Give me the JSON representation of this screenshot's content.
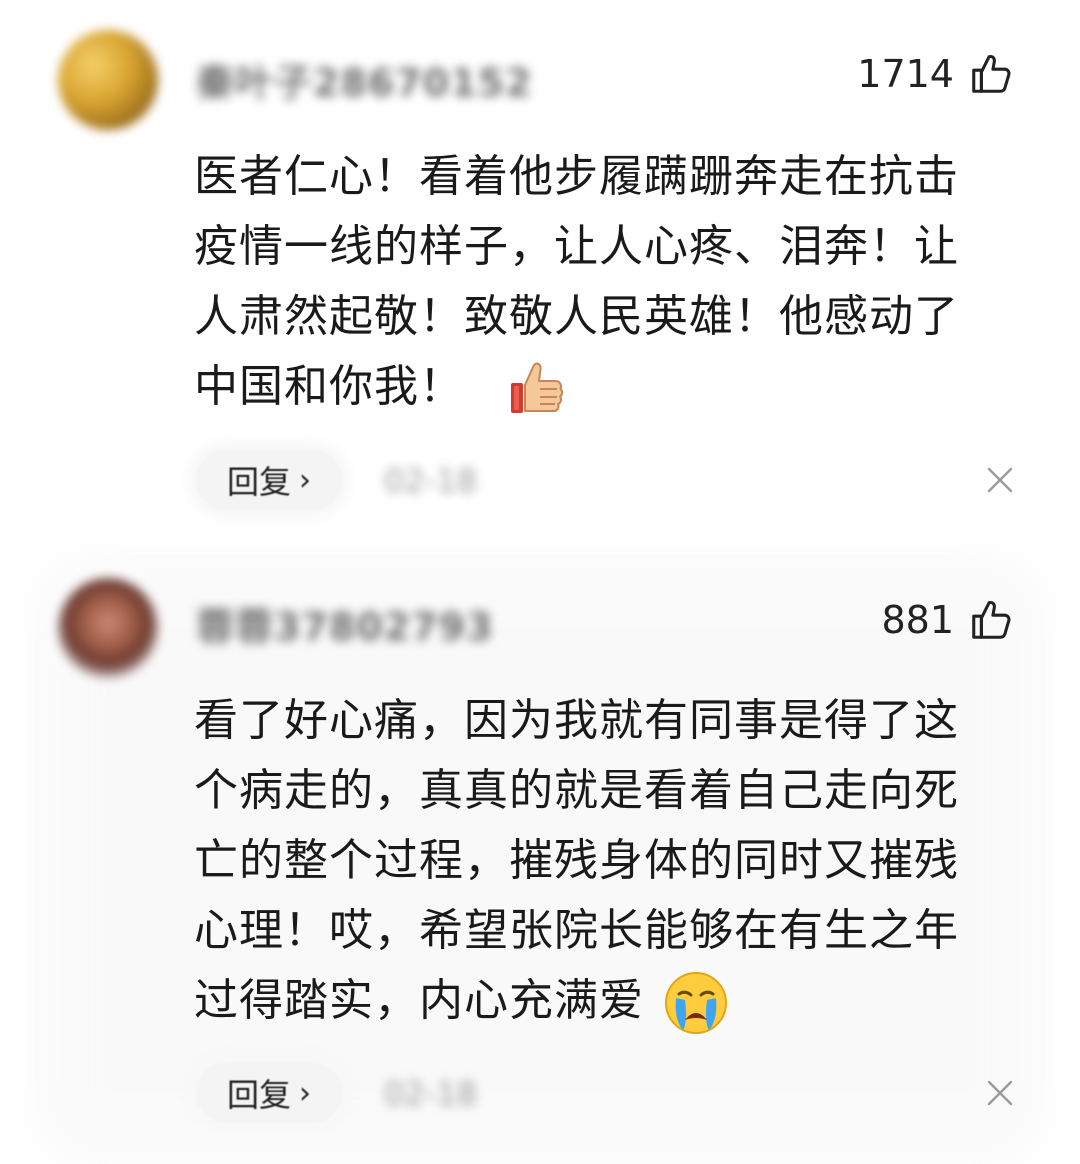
{
  "comments": [
    {
      "username": "秦叶子28670152",
      "likes": "1714",
      "content_lines": [
        "医者仁心！看着他步履蹒跚奔走在抗击",
        "疫情一线的样子，让人心疼、泪奔！让",
        "人肃然起敬！致敬人民英雄！他感动了",
        "中国和你我！"
      ],
      "emoji": "thumbs-up-emoji",
      "reply_label": "回复",
      "reply_chevron": "›",
      "date": "02-18"
    },
    {
      "username": "蓉蓉37802793",
      "likes": "881",
      "content_lines": [
        "看了好心痛，因为我就有同事是得了这",
        "个病走的，真真的就是看着自己走向死",
        "亡的整个过程，摧残身体的同时又摧残",
        "心理！哎，希望张院长能够在有生之年",
        "过得踏实，内心充满爱"
      ],
      "emoji": "crying-face-emoji",
      "reply_label": "回复",
      "reply_chevron": "›",
      "date": "02-18"
    }
  ],
  "icons": {
    "like": "thumbs-up-outline-icon",
    "close": "close-icon"
  },
  "colors": {
    "text": "#1a1a1a",
    "muted": "#9a9a9a",
    "reply_bg": "#f4f4f4"
  }
}
